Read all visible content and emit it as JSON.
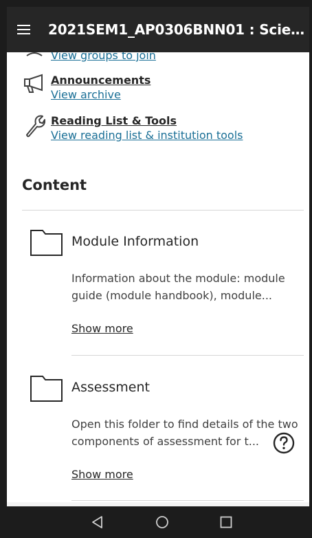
{
  "app_bar": {
    "title": "2021SEM1_AP0306BNN01 : Scient...",
    "menu_icon": "hamburger-menu-icon"
  },
  "tools": [
    {
      "icon": "groups-icon",
      "title": "",
      "link": "View groups to join"
    },
    {
      "icon": "megaphone-icon",
      "title": "Announcements",
      "link": "View archive"
    },
    {
      "icon": "wrench-icon",
      "title": "Reading List & Tools",
      "link": "View reading list & institution tools"
    }
  ],
  "content": {
    "heading": "Content",
    "items": [
      {
        "icon": "folder-icon",
        "title": "Module Information",
        "description": "Information about the module: module guide (module handbook), module...",
        "show_more": "Show more"
      },
      {
        "icon": "folder-icon",
        "title": "Assessment",
        "description": "Open this folder to find details of the two components of assessment for t...",
        "show_more": "Show more"
      }
    ]
  },
  "help_icon": "help-question-icon",
  "nav": {
    "back_icon": "back-triangle-icon",
    "home_icon": "home-circle-icon",
    "recents_icon": "recents-square-icon"
  },
  "colors": {
    "app_bar": "#262626",
    "link": "#1a6f96",
    "text": "#262626"
  }
}
